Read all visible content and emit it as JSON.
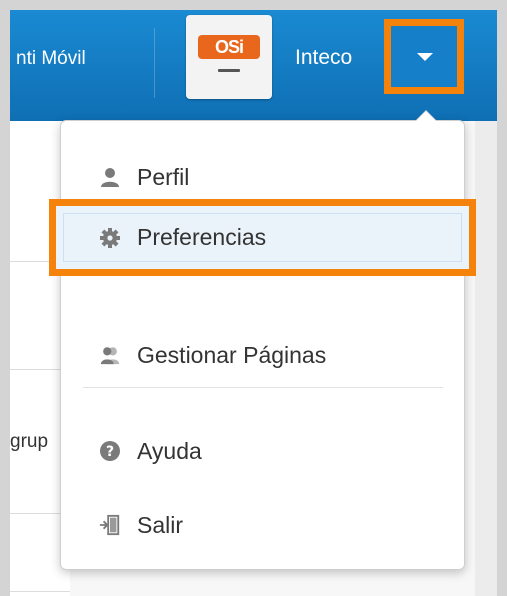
{
  "navbar": {
    "partial_app_title": "nti Móvil",
    "logo_text": "OSi",
    "org_name": "Inteco"
  },
  "content": {
    "clipped_text": "grup"
  },
  "user_menu": {
    "items": [
      {
        "label": "Perfil",
        "icon": "user-icon"
      },
      {
        "label": "Preferencias",
        "icon": "gear-icon",
        "highlighted": true
      },
      {
        "label": "Gestionar Páginas",
        "icon": "users-icon"
      },
      {
        "label": "Ayuda",
        "icon": "help-circle-icon"
      },
      {
        "label": "Salir",
        "icon": "sign-out-icon"
      }
    ]
  },
  "colors": {
    "navbar_blue": "#1580c9",
    "highlight_orange": "#f5820a",
    "logo_orange": "#e8671d",
    "hover_bg": "#eaf2fa"
  }
}
